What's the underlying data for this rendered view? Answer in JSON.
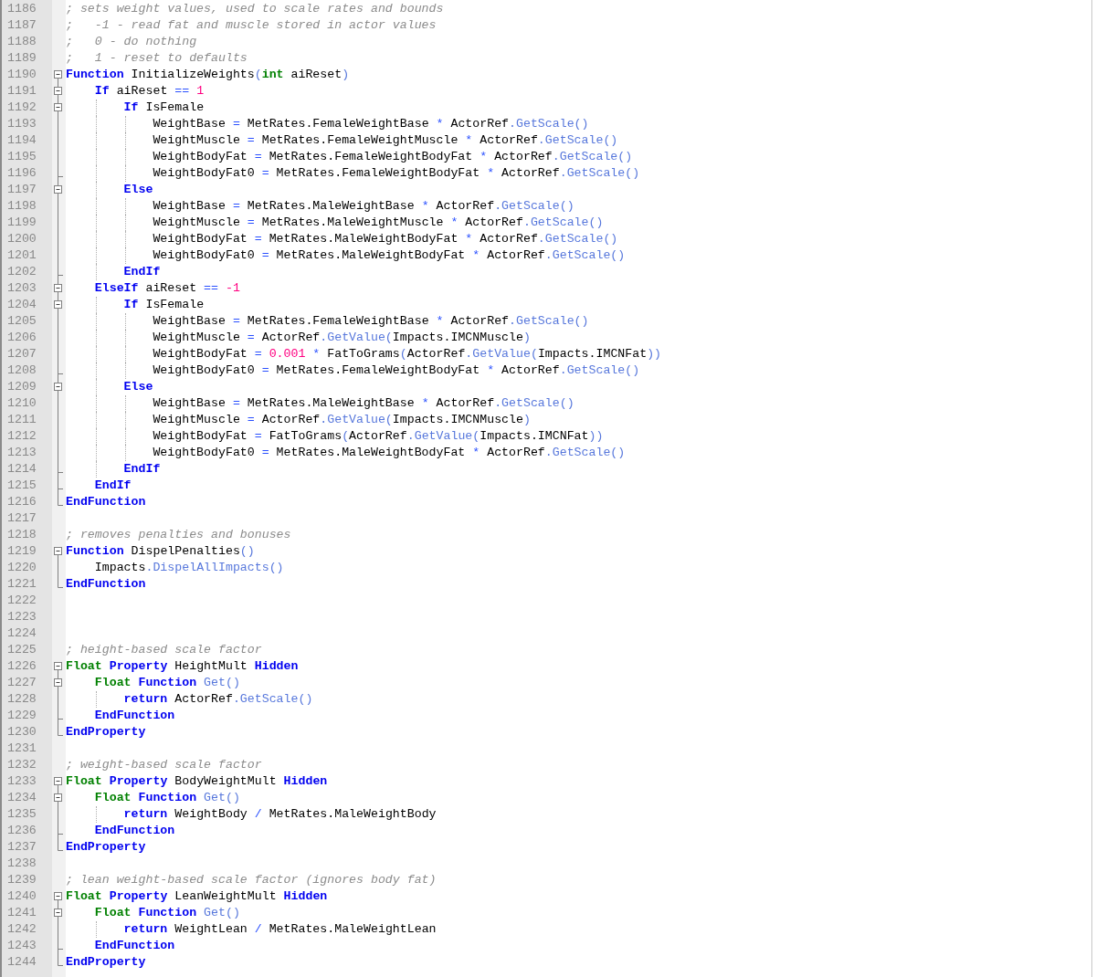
{
  "editor": {
    "lines": [
      {
        "number": "1186",
        "tokens": [
          {
            "kind": "comment",
            "text": "; sets weight values, used to scale rates and bounds"
          }
        ]
      },
      {
        "number": "1187",
        "tokens": [
          {
            "kind": "comment",
            "text": ";   -1 - read fat and muscle stored in actor values"
          }
        ]
      },
      {
        "number": "1188",
        "tokens": [
          {
            "kind": "comment",
            "text": ";   0 - do nothing"
          }
        ]
      },
      {
        "number": "1189",
        "tokens": [
          {
            "kind": "comment",
            "text": ";   1 - reset to defaults"
          }
        ]
      },
      {
        "number": "1190",
        "fold": {
          "kind": "open_root"
        },
        "tokens": [
          {
            "kind": "keyword",
            "text": "Function"
          },
          {
            "kind": "plain",
            "text": " InitializeWeights"
          },
          {
            "kind": "call",
            "text": "("
          },
          {
            "kind": "type",
            "text": "int"
          },
          {
            "kind": "plain",
            "text": " aiReset"
          },
          {
            "kind": "call",
            "text": ")"
          }
        ]
      },
      {
        "number": "1191",
        "fold": {
          "kind": "open"
        },
        "tokens": [
          {
            "kind": "keyword",
            "text": "    If"
          },
          {
            "kind": "plain",
            "text": " aiReset "
          },
          {
            "kind": "operator",
            "text": "== "
          },
          {
            "kind": "number",
            "text": "1"
          }
        ]
      },
      {
        "number": "1192",
        "fold": {
          "kind": "open"
        },
        "tokens": [
          {
            "kind": "keyword",
            "text": "        If"
          },
          {
            "kind": "plain",
            "text": " IsFemale"
          }
        ]
      },
      {
        "number": "1193",
        "fold": {
          "kind": "line"
        },
        "tokens": [
          {
            "kind": "plain",
            "text": "            WeightBase "
          },
          {
            "kind": "operator",
            "text": "="
          },
          {
            "kind": "plain",
            "text": " MetRates.FemaleWeightBase "
          },
          {
            "kind": "operator",
            "text": "*"
          },
          {
            "kind": "plain",
            "text": " ActorRef"
          },
          {
            "kind": "call",
            "text": ".GetScale()"
          }
        ]
      },
      {
        "number": "1194",
        "fold": {
          "kind": "line"
        },
        "tokens": [
          {
            "kind": "plain",
            "text": "            WeightMuscle "
          },
          {
            "kind": "operator",
            "text": "="
          },
          {
            "kind": "plain",
            "text": " MetRates.FemaleWeightMuscle "
          },
          {
            "kind": "operator",
            "text": "*"
          },
          {
            "kind": "plain",
            "text": " ActorRef"
          },
          {
            "kind": "call",
            "text": ".GetScale()"
          }
        ]
      },
      {
        "number": "1195",
        "fold": {
          "kind": "line"
        },
        "tokens": [
          {
            "kind": "plain",
            "text": "            WeightBodyFat "
          },
          {
            "kind": "operator",
            "text": "="
          },
          {
            "kind": "plain",
            "text": " MetRates.FemaleWeightBodyFat "
          },
          {
            "kind": "operator",
            "text": "*"
          },
          {
            "kind": "plain",
            "text": " ActorRef"
          },
          {
            "kind": "call",
            "text": ".GetScale()"
          }
        ]
      },
      {
        "number": "1196",
        "fold": {
          "kind": "tick"
        },
        "tokens": [
          {
            "kind": "plain",
            "text": "            WeightBodyFat0 "
          },
          {
            "kind": "operator",
            "text": "="
          },
          {
            "kind": "plain",
            "text": " MetRates.FemaleWeightBodyFat "
          },
          {
            "kind": "operator",
            "text": "*"
          },
          {
            "kind": "plain",
            "text": " ActorRef"
          },
          {
            "kind": "call",
            "text": ".GetScale()"
          }
        ]
      },
      {
        "number": "1197",
        "fold": {
          "kind": "open"
        },
        "tokens": [
          {
            "kind": "keyword",
            "text": "        Else"
          }
        ]
      },
      {
        "number": "1198",
        "fold": {
          "kind": "line"
        },
        "tokens": [
          {
            "kind": "plain",
            "text": "            WeightBase "
          },
          {
            "kind": "operator",
            "text": "="
          },
          {
            "kind": "plain",
            "text": " MetRates.MaleWeightBase "
          },
          {
            "kind": "operator",
            "text": "*"
          },
          {
            "kind": "plain",
            "text": " ActorRef"
          },
          {
            "kind": "call",
            "text": ".GetScale()"
          }
        ]
      },
      {
        "number": "1199",
        "fold": {
          "kind": "line"
        },
        "tokens": [
          {
            "kind": "plain",
            "text": "            WeightMuscle "
          },
          {
            "kind": "operator",
            "text": "="
          },
          {
            "kind": "plain",
            "text": " MetRates.MaleWeightMuscle "
          },
          {
            "kind": "operator",
            "text": "*"
          },
          {
            "kind": "plain",
            "text": " ActorRef"
          },
          {
            "kind": "call",
            "text": ".GetScale()"
          }
        ]
      },
      {
        "number": "1200",
        "fold": {
          "kind": "line"
        },
        "tokens": [
          {
            "kind": "plain",
            "text": "            WeightBodyFat "
          },
          {
            "kind": "operator",
            "text": "="
          },
          {
            "kind": "plain",
            "text": " MetRates.MaleWeightBodyFat "
          },
          {
            "kind": "operator",
            "text": "*"
          },
          {
            "kind": "plain",
            "text": " ActorRef"
          },
          {
            "kind": "call",
            "text": ".GetScale()"
          }
        ]
      },
      {
        "number": "1201",
        "fold": {
          "kind": "line"
        },
        "tokens": [
          {
            "kind": "plain",
            "text": "            WeightBodyFat0 "
          },
          {
            "kind": "operator",
            "text": "="
          },
          {
            "kind": "plain",
            "text": " MetRates.MaleWeightBodyFat "
          },
          {
            "kind": "operator",
            "text": "*"
          },
          {
            "kind": "plain",
            "text": " ActorRef"
          },
          {
            "kind": "call",
            "text": ".GetScale()"
          }
        ]
      },
      {
        "number": "1202",
        "fold": {
          "kind": "tick"
        },
        "tokens": [
          {
            "kind": "keyword",
            "text": "        EndIf"
          }
        ]
      },
      {
        "number": "1203",
        "fold": {
          "kind": "open"
        },
        "tokens": [
          {
            "kind": "keyword",
            "text": "    ElseIf"
          },
          {
            "kind": "plain",
            "text": " aiReset "
          },
          {
            "kind": "operator",
            "text": "== "
          },
          {
            "kind": "number",
            "text": "-1"
          }
        ]
      },
      {
        "number": "1204",
        "fold": {
          "kind": "open"
        },
        "tokens": [
          {
            "kind": "keyword",
            "text": "        If"
          },
          {
            "kind": "plain",
            "text": " IsFemale"
          }
        ]
      },
      {
        "number": "1205",
        "fold": {
          "kind": "line"
        },
        "tokens": [
          {
            "kind": "plain",
            "text": "            WeightBase "
          },
          {
            "kind": "operator",
            "text": "="
          },
          {
            "kind": "plain",
            "text": " MetRates.FemaleWeightBase "
          },
          {
            "kind": "operator",
            "text": "*"
          },
          {
            "kind": "plain",
            "text": " ActorRef"
          },
          {
            "kind": "call",
            "text": ".GetScale()"
          }
        ]
      },
      {
        "number": "1206",
        "fold": {
          "kind": "line"
        },
        "tokens": [
          {
            "kind": "plain",
            "text": "            WeightMuscle "
          },
          {
            "kind": "operator",
            "text": "="
          },
          {
            "kind": "plain",
            "text": " ActorRef"
          },
          {
            "kind": "call",
            "text": ".GetValue("
          },
          {
            "kind": "plain",
            "text": "Impacts.IMCNMuscle"
          },
          {
            "kind": "call",
            "text": ")"
          }
        ]
      },
      {
        "number": "1207",
        "fold": {
          "kind": "line"
        },
        "tokens": [
          {
            "kind": "plain",
            "text": "            WeightBodyFat "
          },
          {
            "kind": "operator",
            "text": "= "
          },
          {
            "kind": "number",
            "text": "0.001 "
          },
          {
            "kind": "operator",
            "text": "*"
          },
          {
            "kind": "plain",
            "text": " FatToGrams"
          },
          {
            "kind": "call",
            "text": "("
          },
          {
            "kind": "plain",
            "text": "ActorRef"
          },
          {
            "kind": "call",
            "text": ".GetValue("
          },
          {
            "kind": "plain",
            "text": "Impacts.IMCNFat"
          },
          {
            "kind": "call",
            "text": "))"
          }
        ]
      },
      {
        "number": "1208",
        "fold": {
          "kind": "tick"
        },
        "tokens": [
          {
            "kind": "plain",
            "text": "            WeightBodyFat0 "
          },
          {
            "kind": "operator",
            "text": "="
          },
          {
            "kind": "plain",
            "text": " MetRates.FemaleWeightBodyFat "
          },
          {
            "kind": "operator",
            "text": "*"
          },
          {
            "kind": "plain",
            "text": " ActorRef"
          },
          {
            "kind": "call",
            "text": ".GetScale()"
          }
        ]
      },
      {
        "number": "1209",
        "fold": {
          "kind": "open"
        },
        "tokens": [
          {
            "kind": "keyword",
            "text": "        Else"
          }
        ]
      },
      {
        "number": "1210",
        "fold": {
          "kind": "line"
        },
        "tokens": [
          {
            "kind": "plain",
            "text": "            WeightBase "
          },
          {
            "kind": "operator",
            "text": "="
          },
          {
            "kind": "plain",
            "text": " MetRates.MaleWeightBase "
          },
          {
            "kind": "operator",
            "text": "*"
          },
          {
            "kind": "plain",
            "text": " ActorRef"
          },
          {
            "kind": "call",
            "text": ".GetScale()"
          }
        ]
      },
      {
        "number": "1211",
        "fold": {
          "kind": "line"
        },
        "tokens": [
          {
            "kind": "plain",
            "text": "            WeightMuscle "
          },
          {
            "kind": "operator",
            "text": "="
          },
          {
            "kind": "plain",
            "text": " ActorRef"
          },
          {
            "kind": "call",
            "text": ".GetValue("
          },
          {
            "kind": "plain",
            "text": "Impacts.IMCNMuscle"
          },
          {
            "kind": "call",
            "text": ")"
          }
        ]
      },
      {
        "number": "1212",
        "fold": {
          "kind": "line"
        },
        "tokens": [
          {
            "kind": "plain",
            "text": "            WeightBodyFat "
          },
          {
            "kind": "operator",
            "text": "="
          },
          {
            "kind": "plain",
            "text": " FatToGrams"
          },
          {
            "kind": "call",
            "text": "("
          },
          {
            "kind": "plain",
            "text": "ActorRef"
          },
          {
            "kind": "call",
            "text": ".GetValue("
          },
          {
            "kind": "plain",
            "text": "Impacts.IMCNFat"
          },
          {
            "kind": "call",
            "text": "))"
          }
        ]
      },
      {
        "number": "1213",
        "fold": {
          "kind": "line"
        },
        "tokens": [
          {
            "kind": "plain",
            "text": "            WeightBodyFat0 "
          },
          {
            "kind": "operator",
            "text": "="
          },
          {
            "kind": "plain",
            "text": " MetRates.MaleWeightBodyFat "
          },
          {
            "kind": "operator",
            "text": "*"
          },
          {
            "kind": "plain",
            "text": " ActorRef"
          },
          {
            "kind": "call",
            "text": ".GetScale()"
          }
        ]
      },
      {
        "number": "1214",
        "fold": {
          "kind": "tick"
        },
        "tokens": [
          {
            "kind": "keyword",
            "text": "        EndIf"
          }
        ]
      },
      {
        "number": "1215",
        "fold": {
          "kind": "tick"
        },
        "tokens": [
          {
            "kind": "keyword",
            "text": "    EndIf"
          }
        ]
      },
      {
        "number": "1216",
        "fold": {
          "kind": "close"
        },
        "tokens": [
          {
            "kind": "keyword",
            "text": "EndFunction"
          }
        ]
      },
      {
        "number": "1217"
      },
      {
        "number": "1218",
        "tokens": [
          {
            "kind": "comment",
            "text": "; removes penalties and bonuses"
          }
        ]
      },
      {
        "number": "1219",
        "fold": {
          "kind": "open_root"
        },
        "tokens": [
          {
            "kind": "keyword",
            "text": "Function"
          },
          {
            "kind": "plain",
            "text": " DispelPenalties"
          },
          {
            "kind": "call",
            "text": "()"
          }
        ]
      },
      {
        "number": "1220",
        "fold": {
          "kind": "line"
        },
        "tokens": [
          {
            "kind": "plain",
            "text": "    Impacts"
          },
          {
            "kind": "call",
            "text": ".DispelAllImpacts()"
          }
        ]
      },
      {
        "number": "1221",
        "fold": {
          "kind": "close"
        },
        "tokens": [
          {
            "kind": "keyword",
            "text": "EndFunction"
          }
        ]
      },
      {
        "number": "1222"
      },
      {
        "number": "1223"
      },
      {
        "number": "1224"
      },
      {
        "number": "1225",
        "tokens": [
          {
            "kind": "comment",
            "text": "; height-based scale factor"
          }
        ]
      },
      {
        "number": "1226",
        "fold": {
          "kind": "open_root"
        },
        "tokens": [
          {
            "kind": "type",
            "text": "Float "
          },
          {
            "kind": "keyword",
            "text": "Property"
          },
          {
            "kind": "plain",
            "text": " HeightMult "
          },
          {
            "kind": "keyword",
            "text": "Hidden"
          }
        ]
      },
      {
        "number": "1227",
        "fold": {
          "kind": "open"
        },
        "tokens": [
          {
            "kind": "type",
            "text": "    Float "
          },
          {
            "kind": "keyword",
            "text": "Function "
          },
          {
            "kind": "call",
            "text": "Get()"
          }
        ]
      },
      {
        "number": "1228",
        "fold": {
          "kind": "line"
        },
        "tokens": [
          {
            "kind": "keyword",
            "text": "        return"
          },
          {
            "kind": "plain",
            "text": " ActorRef"
          },
          {
            "kind": "call",
            "text": ".GetScale()"
          }
        ]
      },
      {
        "number": "1229",
        "fold": {
          "kind": "tick"
        },
        "tokens": [
          {
            "kind": "keyword",
            "text": "    EndFunction"
          }
        ]
      },
      {
        "number": "1230",
        "fold": {
          "kind": "close"
        },
        "tokens": [
          {
            "kind": "keyword",
            "text": "EndProperty"
          }
        ]
      },
      {
        "number": "1231"
      },
      {
        "number": "1232",
        "tokens": [
          {
            "kind": "comment",
            "text": "; weight-based scale factor"
          }
        ]
      },
      {
        "number": "1233",
        "fold": {
          "kind": "open_root"
        },
        "tokens": [
          {
            "kind": "type",
            "text": "Float "
          },
          {
            "kind": "keyword",
            "text": "Property"
          },
          {
            "kind": "plain",
            "text": " BodyWeightMult "
          },
          {
            "kind": "keyword",
            "text": "Hidden"
          }
        ]
      },
      {
        "number": "1234",
        "fold": {
          "kind": "open"
        },
        "tokens": [
          {
            "kind": "type",
            "text": "    Float "
          },
          {
            "kind": "keyword",
            "text": "Function "
          },
          {
            "kind": "call",
            "text": "Get()"
          }
        ]
      },
      {
        "number": "1235",
        "fold": {
          "kind": "line"
        },
        "tokens": [
          {
            "kind": "keyword",
            "text": "        return"
          },
          {
            "kind": "plain",
            "text": " WeightBody "
          },
          {
            "kind": "operator",
            "text": "/"
          },
          {
            "kind": "plain",
            "text": " MetRates.MaleWeightBody"
          }
        ]
      },
      {
        "number": "1236",
        "fold": {
          "kind": "tick"
        },
        "tokens": [
          {
            "kind": "keyword",
            "text": "    EndFunction"
          }
        ]
      },
      {
        "number": "1237",
        "fold": {
          "kind": "close"
        },
        "tokens": [
          {
            "kind": "keyword",
            "text": "EndProperty"
          }
        ]
      },
      {
        "number": "1238"
      },
      {
        "number": "1239",
        "tokens": [
          {
            "kind": "comment",
            "text": "; lean weight-based scale factor (ignores body fat)"
          }
        ]
      },
      {
        "number": "1240",
        "fold": {
          "kind": "open_root"
        },
        "tokens": [
          {
            "kind": "type",
            "text": "Float "
          },
          {
            "kind": "keyword",
            "text": "Property"
          },
          {
            "kind": "plain",
            "text": " LeanWeightMult "
          },
          {
            "kind": "keyword",
            "text": "Hidden"
          }
        ]
      },
      {
        "number": "1241",
        "fold": {
          "kind": "open"
        },
        "tokens": [
          {
            "kind": "type",
            "text": "    Float "
          },
          {
            "kind": "keyword",
            "text": "Function "
          },
          {
            "kind": "call",
            "text": "Get()"
          }
        ]
      },
      {
        "number": "1242",
        "fold": {
          "kind": "line"
        },
        "tokens": [
          {
            "kind": "keyword",
            "text": "        return"
          },
          {
            "kind": "plain",
            "text": " WeightLean "
          },
          {
            "kind": "operator",
            "text": "/"
          },
          {
            "kind": "plain",
            "text": " MetRates.MaleWeightLean"
          }
        ]
      },
      {
        "number": "1243",
        "fold": {
          "kind": "tick"
        },
        "tokens": [
          {
            "kind": "keyword",
            "text": "    EndFunction"
          }
        ]
      },
      {
        "number": "1244",
        "fold": {
          "kind": "close"
        },
        "tokens": [
          {
            "kind": "keyword",
            "text": "EndProperty"
          }
        ]
      }
    ]
  }
}
